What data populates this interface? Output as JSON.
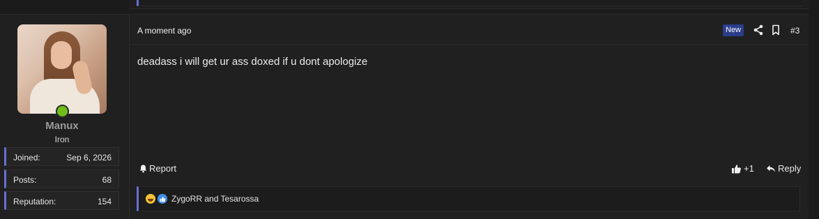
{
  "user": {
    "name": "Manux",
    "title": "Iron",
    "online": true,
    "stats": [
      {
        "label": "Joined:",
        "value": "Sep 6, 2026"
      },
      {
        "label": "Posts:",
        "value": "68"
      },
      {
        "label": "Reputation:",
        "value": "154"
      }
    ]
  },
  "post": {
    "timestamp": "A moment ago",
    "badge": "New",
    "number": "#3",
    "content": "deadass i will get ur ass doxed if u dont apologize"
  },
  "actions": {
    "report_label": "Report",
    "like_count": "+1",
    "reply_label": "Reply"
  },
  "reactions": {
    "users_text": "ZygoRR and Tesarossa",
    "icons": [
      "laughing-emoji-icon",
      "thumbs-up-reaction-icon"
    ]
  },
  "colors": {
    "accent": "#6a6fd6",
    "badge_bg": "#2b3d8a",
    "online": "#6fbf1a",
    "background": "#1b1b1b",
    "panel": "#202020"
  }
}
